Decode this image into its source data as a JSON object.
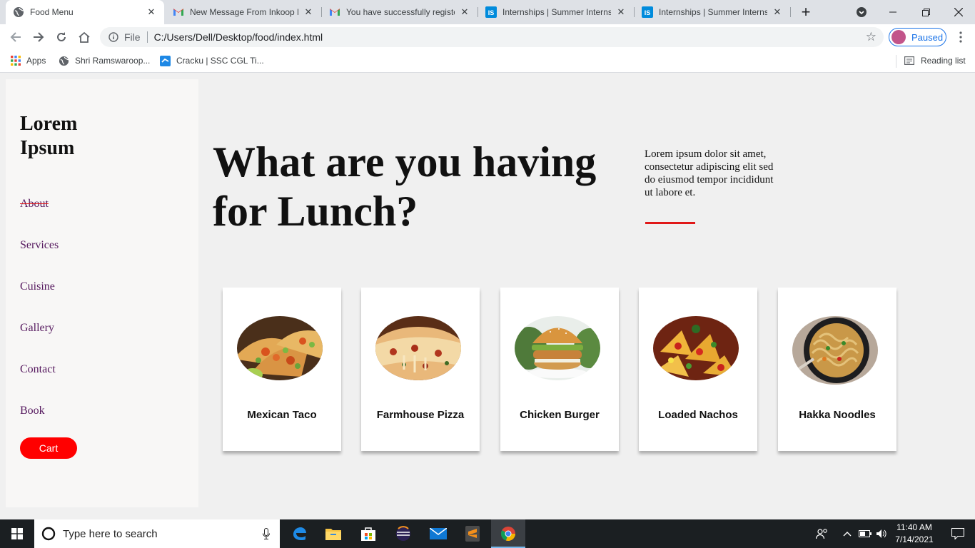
{
  "browser": {
    "tabs": [
      {
        "title": "Food Menu",
        "icon": "globe-icon",
        "active": true
      },
      {
        "title": "New Message From Inkoop F",
        "icon": "gmail-icon"
      },
      {
        "title": "You have successfully registe",
        "icon": "gmail-icon"
      },
      {
        "title": "Internships | Summer Interns",
        "icon": "internshala-icon"
      },
      {
        "title": "Internships | Summer Interns",
        "icon": "internshala-icon"
      }
    ],
    "new_tab_label": "+",
    "address_scheme": "File",
    "address_url": "C:/Users/Dell/Desktop/food/index.html",
    "profile_status": "Paused",
    "bookmarks": [
      {
        "label": "Apps",
        "icon": "apps-grid-icon"
      },
      {
        "label": "Shri Ramswaroop...",
        "icon": "globe-icon"
      },
      {
        "label": "Cracku | SSC CGL Ti...",
        "icon": "cracku-icon"
      }
    ],
    "reading_list": "Reading list"
  },
  "sidebar": {
    "logo": "Lorem Ipsum",
    "nav": [
      {
        "label": "About",
        "struck": true
      },
      {
        "label": "Services"
      },
      {
        "label": "Cuisine"
      },
      {
        "label": "Gallery"
      },
      {
        "label": "Contact"
      },
      {
        "label": "Book"
      }
    ],
    "cart_label": "Cart"
  },
  "main": {
    "headline": "What are you having for Lunch?",
    "intro": "Lorem ipsum dolor sit amet, consectetur adipiscing elit sed do eiusmod tempor incididunt ut labore et.",
    "cards": [
      {
        "name": "Mexican Taco",
        "image": "taco-photo"
      },
      {
        "name": "Farmhouse Pizza",
        "image": "pizza-photo"
      },
      {
        "name": "Chicken Burger",
        "image": "burger-photo"
      },
      {
        "name": "Loaded Nachos",
        "image": "nachos-photo"
      },
      {
        "name": "Hakka Noodles",
        "image": "noodles-photo"
      }
    ]
  },
  "taskbar": {
    "search_placeholder": "Type here to search",
    "time": "11:40 AM",
    "date": "7/14/2021"
  },
  "colors": {
    "accent_red": "#ff0000",
    "nav_link": "#55185e",
    "chrome_tab_bar": "#dee1e6",
    "taskbar": "#1b1f22"
  }
}
